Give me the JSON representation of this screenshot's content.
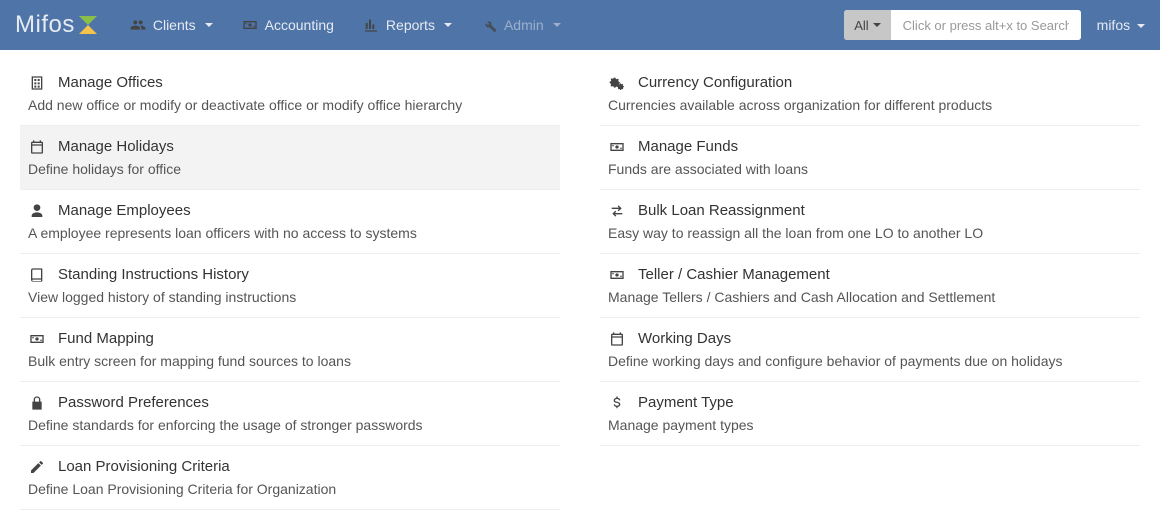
{
  "brand": "Mifos",
  "nav": {
    "clients": "Clients",
    "accounting": "Accounting",
    "reports": "Reports",
    "admin": "Admin"
  },
  "search": {
    "filter": "All",
    "placeholder": "Click or press alt+x to Search"
  },
  "user": "mifos",
  "left_items": [
    {
      "icon": "building",
      "title": "Manage Offices",
      "desc": "Add new office or modify or deactivate office or modify office hierarchy"
    },
    {
      "icon": "calendar",
      "title": "Manage Holidays",
      "desc": "Define holidays for office"
    },
    {
      "icon": "user",
      "title": "Manage Employees",
      "desc": "A employee represents loan officers with no access to systems"
    },
    {
      "icon": "book",
      "title": "Standing Instructions History",
      "desc": "View logged history of standing instructions"
    },
    {
      "icon": "money",
      "title": "Fund Mapping",
      "desc": "Bulk entry screen for mapping fund sources to loans"
    },
    {
      "icon": "lock",
      "title": "Password Preferences",
      "desc": "Define standards for enforcing the usage of stronger passwords"
    },
    {
      "icon": "edit",
      "title": "Loan Provisioning Criteria",
      "desc": "Define Loan Provisioning Criteria for Organization"
    }
  ],
  "right_items": [
    {
      "icon": "cogs",
      "title": "Currency Configuration",
      "desc": "Currencies available across organization for different products"
    },
    {
      "icon": "money",
      "title": "Manage Funds",
      "desc": "Funds are associated with loans"
    },
    {
      "icon": "exchange",
      "title": "Bulk Loan Reassignment",
      "desc": "Easy way to reassign all the loan from one LO to another LO"
    },
    {
      "icon": "money",
      "title": "Teller / Cashier Management",
      "desc": "Manage Tellers / Cashiers and Cash Allocation and Settlement"
    },
    {
      "icon": "calendar",
      "title": "Working Days",
      "desc": "Define working days and configure behavior of payments due on holidays"
    },
    {
      "icon": "dollar",
      "title": "Payment Type",
      "desc": "Manage payment types"
    }
  ]
}
